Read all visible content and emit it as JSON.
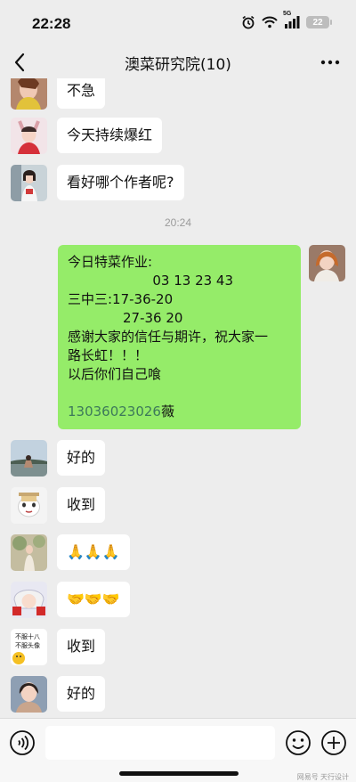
{
  "status_bar": {
    "time": "22:28",
    "network": "5G",
    "battery": "22",
    "icons": [
      "alarm-icon",
      "wifi-icon",
      "signal-icon",
      "battery-icon"
    ]
  },
  "nav": {
    "title": "澳菜研究院(10)",
    "back_icon": "chevron-left-icon",
    "more_icon": "more-dots-icon"
  },
  "messages_before": [
    {
      "sender": "member-1",
      "text": "不急"
    },
    {
      "sender": "member-2",
      "text": "今天持续爆红"
    },
    {
      "sender": "member-3",
      "text": "看好哪个作者呢?"
    }
  ],
  "time_separator": "20:24",
  "own_message": {
    "lines": [
      "今日特菜作业:",
      "                    03 13 23 43",
      "三中三:17-36-20",
      "             27-36 20",
      "感谢大家的信任与期许，祝大家一",
      "路长虹！！！",
      "以后你们自己喰",
      ""
    ],
    "phone": "13036023026",
    "phone_suffix": "薇"
  },
  "messages_after": [
    {
      "sender": "member-4",
      "text": "好的"
    },
    {
      "sender": "member-5",
      "text": "收到"
    },
    {
      "sender": "member-6",
      "text": "🙏🙏🙏"
    },
    {
      "sender": "member-7",
      "text": "🤝🤝🤝"
    },
    {
      "sender": "member-8",
      "text": "收到",
      "avatar_text": "不服十八 不服头像"
    },
    {
      "sender": "member-9",
      "text": "好的"
    }
  ],
  "input_bar": {
    "voice_icon": "voice-icon",
    "emoji_icon": "emoji-icon",
    "plus_icon": "plus-icon",
    "watermark": "网易号 天行设计"
  },
  "colors": {
    "background": "#ededed",
    "own_bubble": "#95ec69",
    "other_bubble": "#ffffff",
    "phone_link": "#3d7a5a"
  }
}
